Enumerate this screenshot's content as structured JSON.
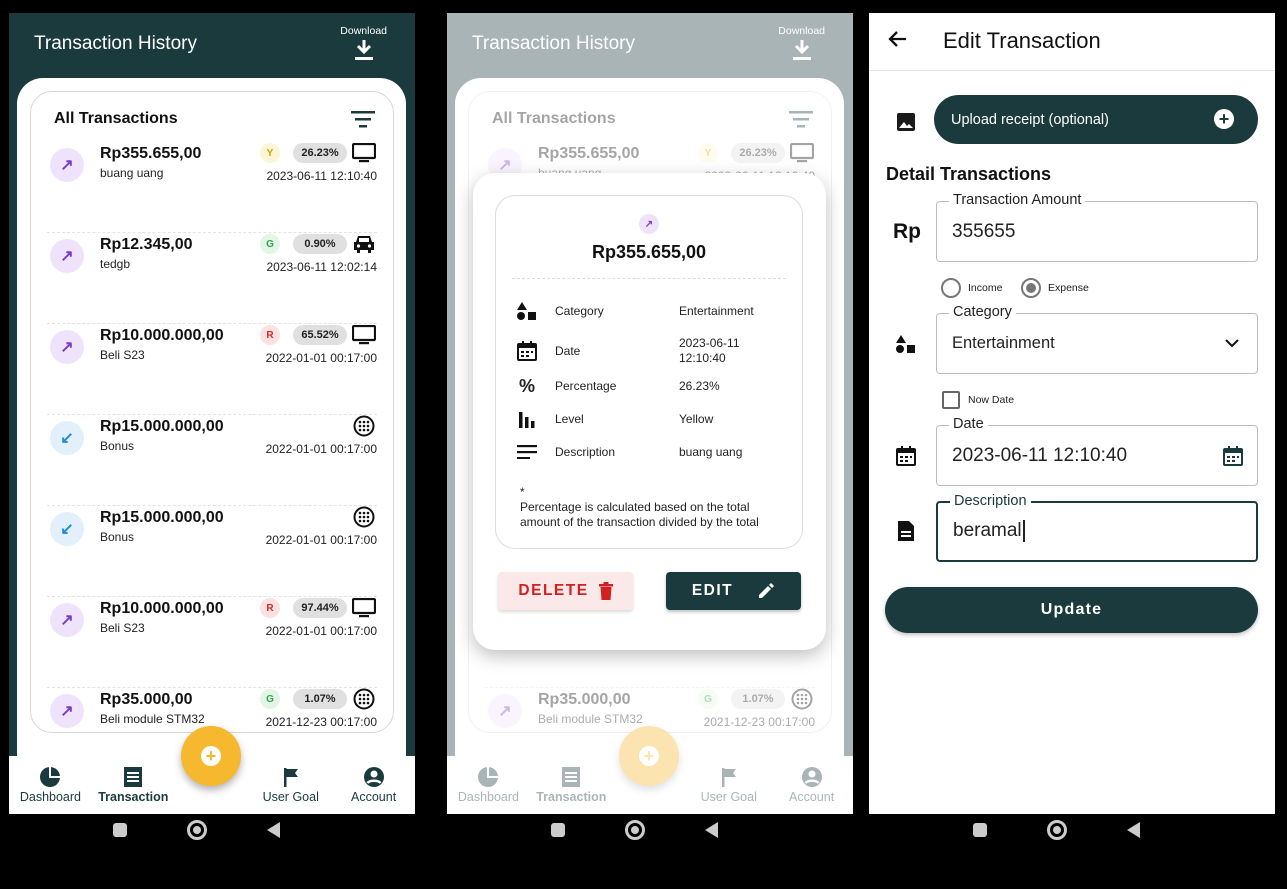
{
  "colors": {
    "primary": "#1b3a3d",
    "accent": "#f5b82e",
    "danger": "#d21f1f",
    "expense": "#7a3fc9",
    "income": "#1d8bd6"
  },
  "history": {
    "title": "Transaction History",
    "download_label": "Download",
    "list_title": "All Transactions",
    "transactions": [
      {
        "amount": "Rp355.655,00",
        "desc": "buang uang",
        "level": "Y",
        "pct": "26.23%",
        "date": "2023-06-11 12:10:40",
        "type": "expense",
        "category_icon": "tv-icon"
      },
      {
        "amount": "Rp12.345,00",
        "desc": "tedgb",
        "level": "G",
        "pct": "0.90%",
        "date": "2023-06-11 12:02:14",
        "type": "expense",
        "category_icon": "car-icon"
      },
      {
        "amount": "Rp10.000.000,00",
        "desc": "Beli S23",
        "level": "R",
        "pct": "65.52%",
        "date": "2022-01-01 00:17:00",
        "type": "expense",
        "category_icon": "tv-icon"
      },
      {
        "amount": "Rp15.000.000,00",
        "desc": "Bonus",
        "level": "",
        "pct": "",
        "date": "2022-01-01 00:17:00",
        "type": "income",
        "category_icon": "dots-circle-icon"
      },
      {
        "amount": "Rp15.000.000,00",
        "desc": "Bonus",
        "level": "",
        "pct": "",
        "date": "2022-01-01 00:17:00",
        "type": "income",
        "category_icon": "dots-circle-icon"
      },
      {
        "amount": "Rp10.000.000,00",
        "desc": "Beli S23",
        "level": "R",
        "pct": "97.44%",
        "date": "2022-01-01 00:17:00",
        "type": "expense",
        "category_icon": "tv-icon"
      },
      {
        "amount": "Rp35.000,00",
        "desc": "Beli module STM32",
        "level": "G",
        "pct": "1.07%",
        "date": "2021-12-23 00:17:00",
        "type": "expense",
        "category_icon": "dots-circle-icon"
      }
    ]
  },
  "nav": {
    "dashboard": "Dashboard",
    "transaction": "Transaction",
    "user_goal": "User Goal",
    "account": "Account"
  },
  "modal": {
    "amount": "Rp355.655,00",
    "rows": [
      {
        "label": "Category",
        "value": "Entertainment"
      },
      {
        "label": "Date",
        "value": "2023-06-11 12:10:40"
      },
      {
        "label": "Percentage",
        "value": "26.23%"
      },
      {
        "label": "Level",
        "value": "Yellow"
      },
      {
        "label": "Description",
        "value": "buang uang"
      }
    ],
    "note_star": "*",
    "note": "Percentage is calculated based on the total amount of the transaction divided by the total",
    "delete_label": "DELETE",
    "edit_label": "EDIT"
  },
  "edit": {
    "title": "Edit Transaction",
    "upload_label": "Upload receipt (optional)",
    "section_title": "Detail Transactions",
    "currency": "Rp",
    "amount_label": "Transaction Amount",
    "amount_value": "355655",
    "income_label": "Income",
    "expense_label": "Expense",
    "selected_type": "expense",
    "category_label": "Category",
    "category_value": "Entertainment",
    "now_date_label": "Now Date",
    "date_label": "Date",
    "date_value": "2023-06-11 12:10:40",
    "description_label": "Description",
    "description_value": "beramal",
    "update_label": "Update"
  }
}
